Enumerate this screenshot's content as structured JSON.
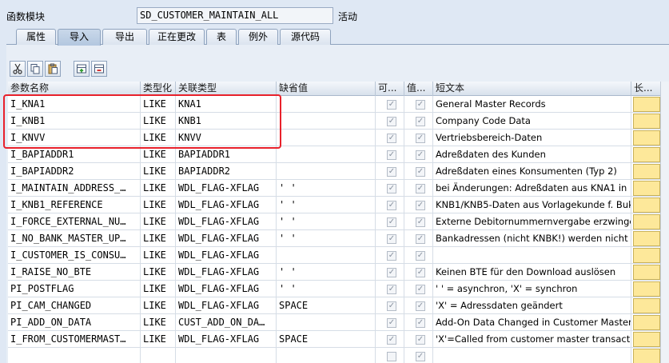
{
  "header": {
    "fm_label": "函数模块",
    "fm_name": "SD_CUSTOMER_MAINTAIN_ALL",
    "fm_status": "活动"
  },
  "tabs": [
    "属性",
    "导入",
    "导出",
    "正在更改",
    "表",
    "例外",
    "源代码"
  ],
  "active_tab": 1,
  "toolbar_icons": [
    "scissors-icon",
    "copy-icon",
    "paste-icon",
    "insert-row-icon",
    "delete-row-icon"
  ],
  "columns": [
    "参数名称",
    "类型化",
    "关联类型",
    "缺省值",
    "可...",
    "值...",
    "短文本",
    "长..."
  ],
  "rows": [
    {
      "param": "I_KNA1",
      "typing": "LIKE",
      "ref": "KNA1",
      "default": "",
      "optional": true,
      "pass_value": true,
      "text": "General Master Records"
    },
    {
      "param": "I_KNB1",
      "typing": "LIKE",
      "ref": "KNB1",
      "default": "",
      "optional": true,
      "pass_value": true,
      "text": "Company Code Data"
    },
    {
      "param": "I_KNVV",
      "typing": "LIKE",
      "ref": "KNVV",
      "default": "",
      "optional": true,
      "pass_value": true,
      "text": "Vertriebsbereich-Daten"
    },
    {
      "param": "I_BAPIADDR1",
      "typing": "LIKE",
      "ref": "BAPIADDR1",
      "default": "",
      "optional": true,
      "pass_value": true,
      "text": "Adreßdaten des Kunden"
    },
    {
      "param": "I_BAPIADDR2",
      "typing": "LIKE",
      "ref": "BAPIADDR2",
      "default": "",
      "optional": true,
      "pass_value": true,
      "text": "Adreßdaten eines Konsumenten (Typ 2)"
    },
    {
      "param": "I_MAINTAIN_ADDRESS_…",
      "typing": "LIKE",
      "ref": "WDL_FLAG-XFLAG",
      "default": "' '",
      "optional": true,
      "pass_value": true,
      "text": "bei Änderungen: Adreßdaten aus KNA1 in …"
    },
    {
      "param": "I_KNB1_REFERENCE",
      "typing": "LIKE",
      "ref": "WDL_FLAG-XFLAG",
      "default": "' '",
      "optional": true,
      "pass_value": true,
      "text": "KNB1/KNB5-Daten aus Vorlagekunde f. Buk…"
    },
    {
      "param": "I_FORCE_EXTERNAL_NU…",
      "typing": "LIKE",
      "ref": "WDL_FLAG-XFLAG",
      "default": "' '",
      "optional": true,
      "pass_value": true,
      "text": "Externe Debitornummernvergabe erzwingen"
    },
    {
      "param": "I_NO_BANK_MASTER_UP…",
      "typing": "LIKE",
      "ref": "WDL_FLAG-XFLAG",
      "default": "' '",
      "optional": true,
      "pass_value": true,
      "text": "Bankadressen (nicht KNBK!) werden nicht …"
    },
    {
      "param": "I_CUSTOMER_IS_CONSU…",
      "typing": "LIKE",
      "ref": "WDL_FLAG-XFLAG",
      "default": "",
      "optional": true,
      "pass_value": true,
      "text": ""
    },
    {
      "param": "I_RAISE_NO_BTE",
      "typing": "LIKE",
      "ref": "WDL_FLAG-XFLAG",
      "default": "' '",
      "optional": true,
      "pass_value": true,
      "text": "Keinen BTE für den Download auslösen"
    },
    {
      "param": "PI_POSTFLAG",
      "typing": "LIKE",
      "ref": "WDL_FLAG-XFLAG",
      "default": "' '",
      "optional": true,
      "pass_value": true,
      "text": "' ' = asynchron, 'X' = synchron"
    },
    {
      "param": "PI_CAM_CHANGED",
      "typing": "LIKE",
      "ref": "WDL_FLAG-XFLAG",
      "default": "SPACE",
      "optional": true,
      "pass_value": true,
      "text": "'X' = Adressdaten geändert"
    },
    {
      "param": "PI_ADD_ON_DATA",
      "typing": "LIKE",
      "ref": "CUST_ADD_ON_DA…",
      "default": "",
      "optional": true,
      "pass_value": true,
      "text": "Add-On Data Changed in Customer Master"
    },
    {
      "param": "I_FROM_CUSTOMERMAST…",
      "typing": "LIKE",
      "ref": "WDL_FLAG-XFLAG",
      "default": "SPACE",
      "optional": true,
      "pass_value": true,
      "text": "'X'=Called from customer master transaction"
    },
    {
      "param": "",
      "typing": "",
      "ref": "",
      "default": "",
      "optional": false,
      "pass_value": true,
      "text": ""
    }
  ],
  "colors": {
    "highlight": "#e8212b",
    "long_text_button": "#fde89a"
  }
}
